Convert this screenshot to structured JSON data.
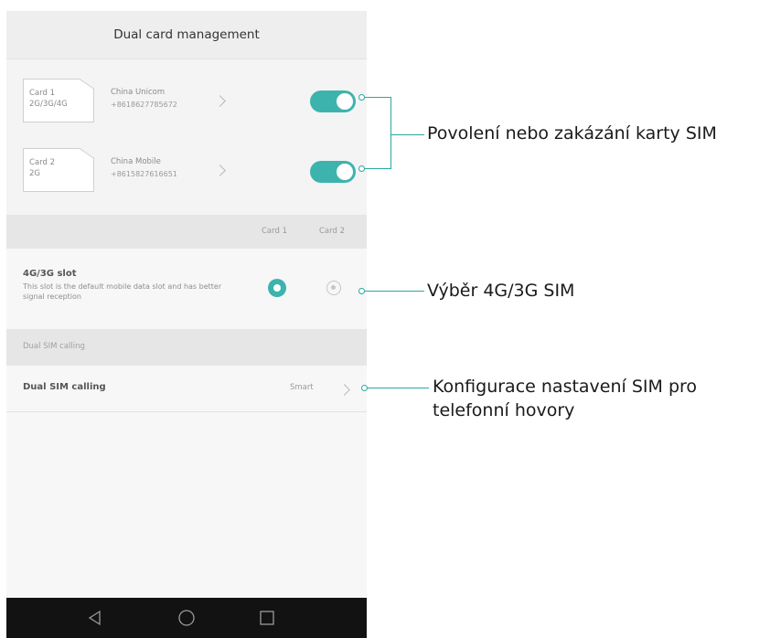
{
  "screen": {
    "title": "Dual card management"
  },
  "cards": [
    {
      "slot_label": "Card 1",
      "network_label": "2G/3G/4G",
      "operator": "China Unicom",
      "number": "+8618627785672",
      "enabled": true
    },
    {
      "slot_label": "Card 2",
      "network_label": "2G",
      "operator": "China Mobile",
      "number": "+8615827616651",
      "enabled": true
    }
  ],
  "columns": {
    "card1": "Card 1",
    "card2": "Card 2"
  },
  "slot_setting": {
    "title": "4G/3G slot",
    "description": "This slot is the default mobile data slot and has better signal reception",
    "selected": "Card 1"
  },
  "dual_sim": {
    "section_header": "Dual SIM calling",
    "row_label": "Dual SIM calling",
    "row_value": "Smart"
  },
  "navbar": {
    "back_icon": "back-triangle-icon",
    "home_icon": "home-circle-icon",
    "recents_icon": "recents-square-icon"
  },
  "callouts": {
    "enable_sim": "Povolení nebo zakázání karty SIM",
    "select_4g": "Výběr 4G/3G SIM",
    "config_sim": "Konfigurace nastavení SIM pro telefonní hovory"
  },
  "colors": {
    "accent": "#3cb4ad",
    "callout_line": "#2aa8a0",
    "navbar": "#121212"
  }
}
